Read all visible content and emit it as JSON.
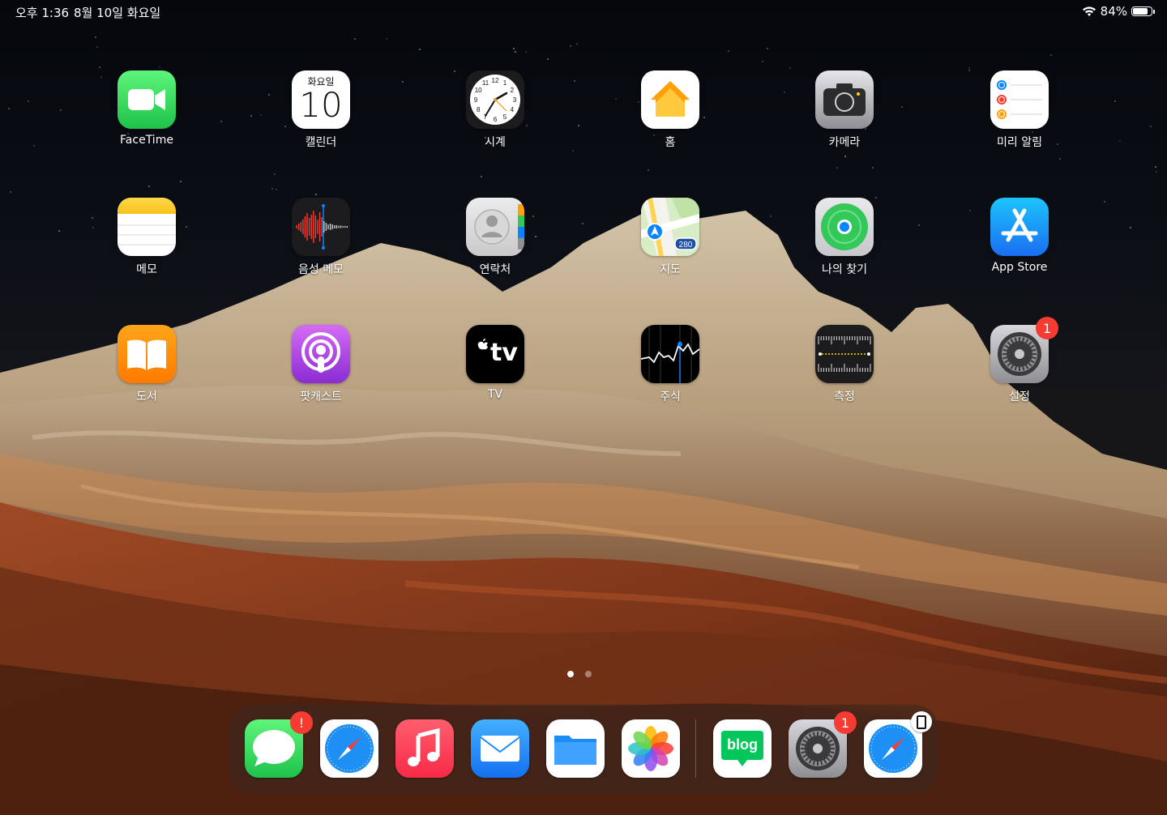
{
  "status_bar": {
    "time": "오후 1:36",
    "date": "8월 10일 화요일",
    "battery_percent_label": "84%",
    "battery_level": 0.84
  },
  "apps": [
    {
      "label": "FaceTime",
      "icon": "facetime-icon"
    },
    {
      "label": "캘린더",
      "icon": "calendar-icon",
      "calendar_day": "화요일",
      "calendar_date": "10"
    },
    {
      "label": "시계",
      "icon": "clock-icon",
      "clock_numbers": [
        "12",
        "1",
        "2",
        "3",
        "4",
        "5",
        "6",
        "7",
        "8",
        "9",
        "10",
        "11"
      ]
    },
    {
      "label": "홈",
      "icon": "home-icon"
    },
    {
      "label": "카메라",
      "icon": "camera-icon"
    },
    {
      "label": "미리 알림",
      "icon": "reminders-icon"
    },
    {
      "label": "메모",
      "icon": "notes-icon"
    },
    {
      "label": "음성 메모",
      "icon": "voice-memos-icon"
    },
    {
      "label": "연락처",
      "icon": "contacts-icon"
    },
    {
      "label": "지도",
      "icon": "maps-icon",
      "map_route": "280"
    },
    {
      "label": "나의 찾기",
      "icon": "find-my-icon"
    },
    {
      "label": "App Store",
      "icon": "app-store-icon"
    },
    {
      "label": "도서",
      "icon": "books-icon"
    },
    {
      "label": "팟캐스트",
      "icon": "podcasts-icon"
    },
    {
      "label": "TV",
      "icon": "tv-icon",
      "icon_text": "tv"
    },
    {
      "label": "주식",
      "icon": "stocks-icon"
    },
    {
      "label": "측정",
      "icon": "measure-icon"
    },
    {
      "label": "설정",
      "icon": "settings-icon",
      "badge": "1"
    }
  ],
  "page_dots": {
    "count": 2,
    "active": 0
  },
  "dock": {
    "apps": [
      {
        "name": "messages",
        "icon": "messages-icon",
        "badge": "!"
      },
      {
        "name": "safari",
        "icon": "safari-icon"
      },
      {
        "name": "music",
        "icon": "music-icon"
      },
      {
        "name": "mail",
        "icon": "mail-icon"
      },
      {
        "name": "files",
        "icon": "files-icon"
      },
      {
        "name": "photos",
        "icon": "photos-icon"
      }
    ],
    "recent_apps": [
      {
        "name": "blog",
        "icon": "blog-icon",
        "icon_text": "blog"
      },
      {
        "name": "settings",
        "icon": "settings-icon",
        "badge": "1"
      },
      {
        "name": "safari-handoff",
        "icon": "safari-icon",
        "handoff": true
      }
    ]
  },
  "colors": {
    "badge": "#f53b32",
    "facetime": "#2fd158",
    "appstore": "#1a8cf5",
    "books": "#ff8a00",
    "podcasts": "#b24de0",
    "music": "#fb3c53",
    "mail": "#1b8cf5",
    "blog": "#03c75a"
  }
}
